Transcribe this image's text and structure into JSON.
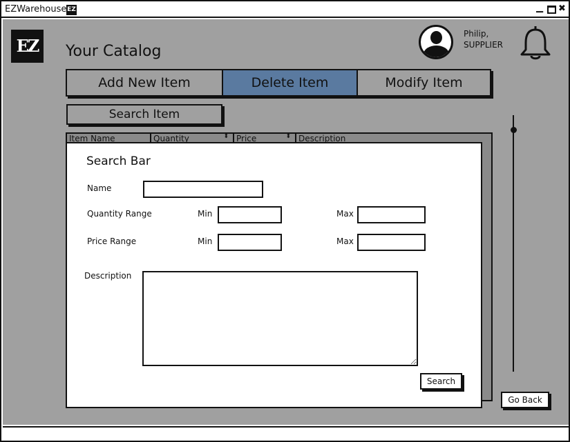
{
  "window": {
    "title": "EZWarehouse",
    "app_badge": "EZ",
    "controls": {
      "minimize": "▁",
      "close": "✖"
    }
  },
  "logo": "EZ",
  "page_title": "Your Catalog",
  "user": {
    "name": "Philip,",
    "role": "SUPPLIER"
  },
  "icons": {
    "avatar": "user-avatar-icon",
    "bell": "bell-icon"
  },
  "tabs": [
    {
      "label": "Add New Item",
      "active": false
    },
    {
      "label": "Delete Item",
      "active": true
    },
    {
      "label": "Modify Item",
      "active": false
    }
  ],
  "search_item_label": "Search Item",
  "table": {
    "columns": [
      "Item Name",
      "Quantity",
      "Price",
      "Description"
    ],
    "sort_icon": "⬍"
  },
  "go_back_label": "Go Back",
  "search_panel": {
    "title": "Search Bar",
    "name_label": "Name",
    "quantity_range_label": "Quantity Range",
    "price_range_label": "Price Range",
    "min_label": "Min",
    "max_label": "Max",
    "description_label": "Description",
    "search_button": "Search",
    "values": {
      "name": "",
      "quantity_min": "",
      "quantity_max": "",
      "price_min": "",
      "price_max": "",
      "description": ""
    }
  },
  "colors": {
    "background": "#a0a0a0",
    "active_tab": "#5a7aa0",
    "grid_body": "#8a8a8a"
  }
}
